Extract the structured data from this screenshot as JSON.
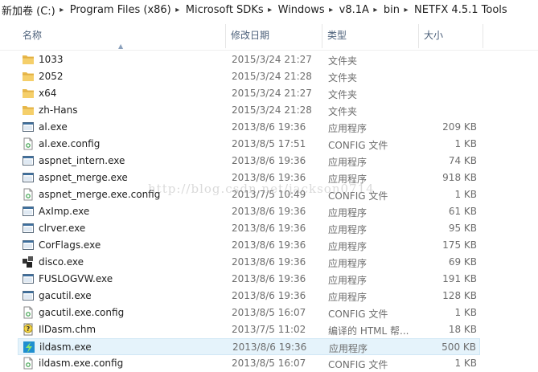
{
  "breadcrumb": [
    {
      "label": "新加卷 (C:)"
    },
    {
      "label": "Program Files (x86)"
    },
    {
      "label": "Microsoft SDKs"
    },
    {
      "label": "Windows"
    },
    {
      "label": "v8.1A"
    },
    {
      "label": "bin"
    },
    {
      "label": "NETFX 4.5.1 Tools"
    }
  ],
  "columns": {
    "name": "名称",
    "date": "修改日期",
    "type": "类型",
    "size": "大小"
  },
  "files": [
    {
      "name": "1033",
      "date": "2015/3/24 21:27",
      "type": "文件夹",
      "size": "",
      "icon": "folder-icon"
    },
    {
      "name": "2052",
      "date": "2015/3/24 21:28",
      "type": "文件夹",
      "size": "",
      "icon": "folder-icon"
    },
    {
      "name": "x64",
      "date": "2015/3/24 21:27",
      "type": "文件夹",
      "size": "",
      "icon": "folder-icon"
    },
    {
      "name": "zh-Hans",
      "date": "2015/3/24 21:28",
      "type": "文件夹",
      "size": "",
      "icon": "folder-icon"
    },
    {
      "name": "al.exe",
      "date": "2013/8/6 19:36",
      "type": "应用程序",
      "size": "209 KB",
      "icon": "exe-icon"
    },
    {
      "name": "al.exe.config",
      "date": "2013/8/5 17:51",
      "type": "CONFIG 文件",
      "size": "1 KB",
      "icon": "config-file-icon"
    },
    {
      "name": "aspnet_intern.exe",
      "date": "2013/8/6 19:36",
      "type": "应用程序",
      "size": "74 KB",
      "icon": "exe-icon"
    },
    {
      "name": "aspnet_merge.exe",
      "date": "2013/8/6 19:36",
      "type": "应用程序",
      "size": "918 KB",
      "icon": "exe-icon"
    },
    {
      "name": "aspnet_merge.exe.config",
      "date": "2013/7/5 10:49",
      "type": "CONFIG 文件",
      "size": "1 KB",
      "icon": "config-file-icon"
    },
    {
      "name": "AxImp.exe",
      "date": "2013/8/6 19:36",
      "type": "应用程序",
      "size": "61 KB",
      "icon": "exe-icon"
    },
    {
      "name": "clrver.exe",
      "date": "2013/8/6 19:36",
      "type": "应用程序",
      "size": "95 KB",
      "icon": "exe-icon"
    },
    {
      "name": "CorFlags.exe",
      "date": "2013/8/6 19:36",
      "type": "应用程序",
      "size": "175 KB",
      "icon": "exe-icon"
    },
    {
      "name": "disco.exe",
      "date": "2013/8/6 19:36",
      "type": "应用程序",
      "size": "69 KB",
      "icon": "disco-exe-icon"
    },
    {
      "name": "FUSLOGVW.exe",
      "date": "2013/8/6 19:36",
      "type": "应用程序",
      "size": "191 KB",
      "icon": "exe-icon"
    },
    {
      "name": "gacutil.exe",
      "date": "2013/8/6 19:36",
      "type": "应用程序",
      "size": "128 KB",
      "icon": "exe-icon"
    },
    {
      "name": "gacutil.exe.config",
      "date": "2013/8/5 16:07",
      "type": "CONFIG 文件",
      "size": "1 KB",
      "icon": "config-file-icon"
    },
    {
      "name": "IlDasm.chm",
      "date": "2013/7/5 11:02",
      "type": "编译的 HTML 帮...",
      "size": "18 KB",
      "icon": "chm-help-icon"
    },
    {
      "name": "ildasm.exe",
      "date": "2013/8/6 19:36",
      "type": "应用程序",
      "size": "500 KB",
      "icon": "ildasm-exe-icon",
      "selected": true
    },
    {
      "name": "ildasm.exe.config",
      "date": "2013/8/5 16:07",
      "type": "CONFIG 文件",
      "size": "1 KB",
      "icon": "config-file-icon"
    }
  ],
  "watermark": "http://blog.csdn.net/jackson0714",
  "colors": {
    "header_text": "#4c607a",
    "selected_bg": "#e5f3fb",
    "folder": "#e8b84a"
  }
}
